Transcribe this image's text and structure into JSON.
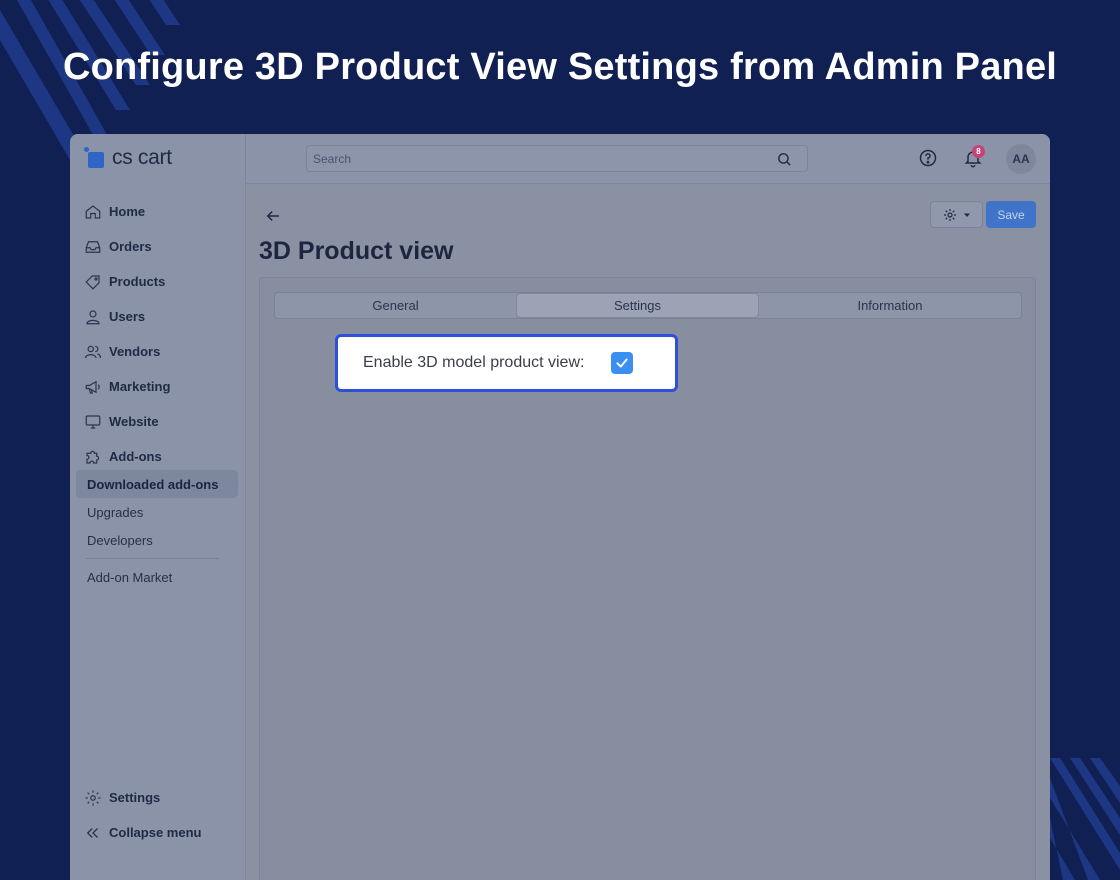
{
  "banner": {
    "title": "Configure 3D Product View Settings from Admin Panel"
  },
  "logo": {
    "text": "cs cart"
  },
  "topbar": {
    "search_placeholder": "Search",
    "notification_count": "8",
    "avatar_initials": "AA"
  },
  "sidebar": {
    "items": [
      {
        "label": "Home",
        "icon": "home-icon"
      },
      {
        "label": "Orders",
        "icon": "inbox-icon"
      },
      {
        "label": "Products",
        "icon": "tag-icon"
      },
      {
        "label": "Users",
        "icon": "user-icon"
      },
      {
        "label": "Vendors",
        "icon": "users-icon"
      },
      {
        "label": "Marketing",
        "icon": "megaphone-icon"
      },
      {
        "label": "Website",
        "icon": "monitor-icon"
      },
      {
        "label": "Add-ons",
        "icon": "puzzle-icon"
      }
    ],
    "subitems": [
      "Downloaded add-ons",
      "Upgrades",
      "Developers",
      "Add-on Market"
    ],
    "active_subitem": "Downloaded add-ons",
    "settings_label": "Settings",
    "collapse_label": "Collapse menu"
  },
  "page": {
    "title": "3D Product view",
    "save_label": "Save",
    "tabs": [
      "General",
      "Settings",
      "Information"
    ],
    "active_tab": "Settings"
  },
  "setting": {
    "label": "Enable 3D model product view:",
    "checked": true
  },
  "colors": {
    "background": "#112053",
    "accent": "#3b8ff0",
    "highlight_border": "#2e4fd8"
  }
}
